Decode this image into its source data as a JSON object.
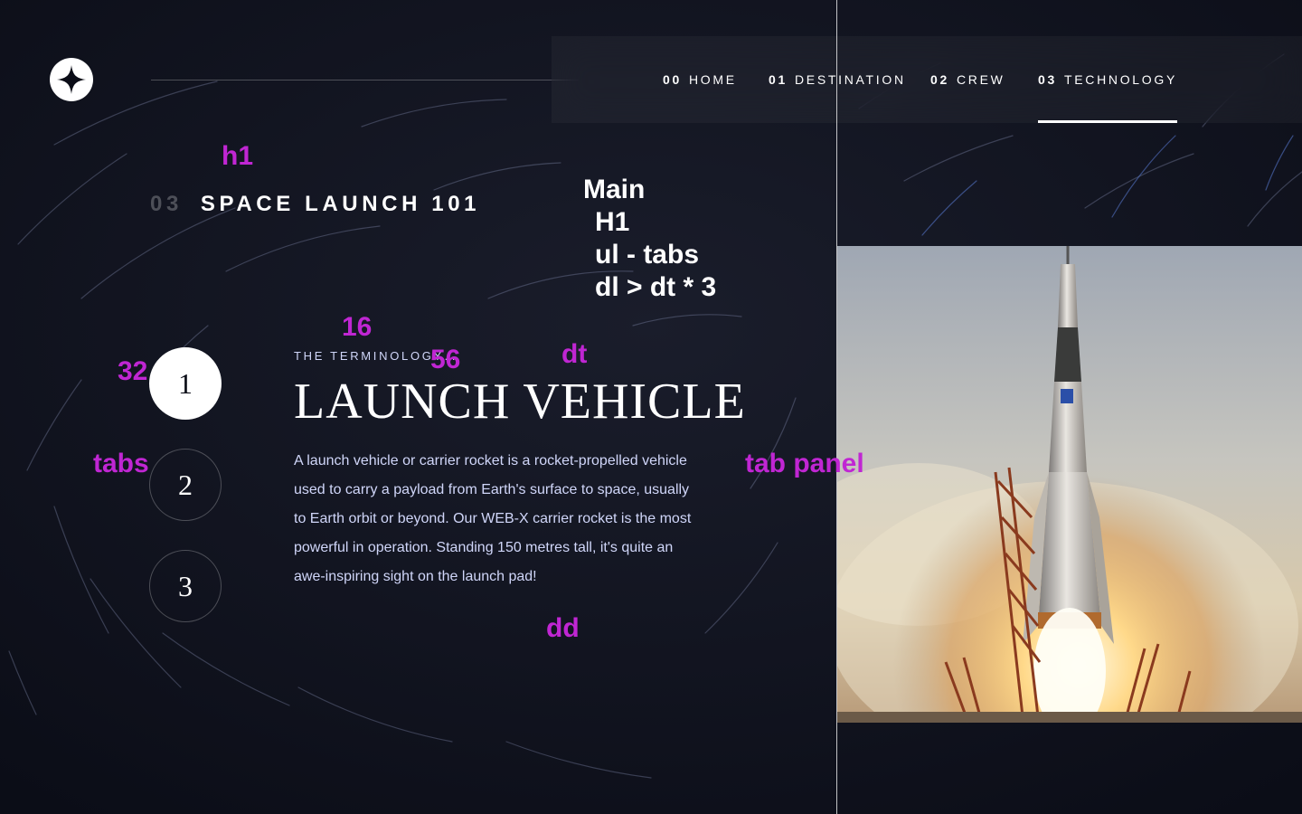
{
  "nav": {
    "items": [
      {
        "num": "00",
        "label": "HOME"
      },
      {
        "num": "01",
        "label": "DESTINATION"
      },
      {
        "num": "02",
        "label": "CREW"
      },
      {
        "num": "03",
        "label": "TECHNOLOGY"
      }
    ],
    "active_index": 3
  },
  "page": {
    "title_num": "03",
    "title_label": "SPACE LAUNCH 101"
  },
  "tabs": [
    "1",
    "2",
    "3"
  ],
  "active_tab": 0,
  "content": {
    "label": "THE TERMINOLOGY…",
    "title": "LAUNCH VEHICLE",
    "description": "A launch vehicle or carrier rocket is a rocket-propelled vehicle used to carry a payload from Earth's surface to space, usually to Earth orbit or beyond. Our WEB-X carrier rocket is the most powerful in operation. Standing 150 metres tall, it's quite an awe-inspiring sight on the launch pad!"
  },
  "annotations": {
    "h1": "h1",
    "outline": [
      "Main",
      "H1",
      "ul - tabs",
      "dl > dt * 3"
    ],
    "size_16": "16",
    "size_56": "56",
    "size_32": "32",
    "dt": "dt",
    "tabs": "tabs",
    "tab_panel": "tab panel",
    "dd": "dd"
  },
  "colors": {
    "background": "#0b0d17",
    "text_secondary": "#d0d6f9",
    "annotation": "#c026d3"
  },
  "icons": {
    "logo": "star-logo-icon"
  }
}
